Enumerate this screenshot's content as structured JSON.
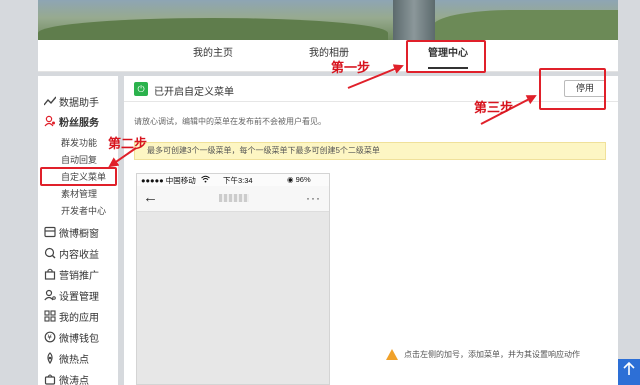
{
  "topnav": {
    "tabs": [
      {
        "label": "我的主页"
      },
      {
        "label": "我的相册"
      },
      {
        "label": "管理中心"
      }
    ]
  },
  "sidebar": {
    "items": [
      {
        "label": "数据助手",
        "icon": "chart-line-icon"
      },
      {
        "label": "粉丝服务",
        "icon": "fans-icon"
      },
      {
        "label": "微博橱窗",
        "icon": "showcase-icon"
      },
      {
        "label": "内容收益",
        "icon": "revenue-icon"
      },
      {
        "label": "营销推广",
        "icon": "marketing-bag-icon"
      },
      {
        "label": "设置管理",
        "icon": "settings-user-icon"
      },
      {
        "label": "我的应用",
        "icon": "apps-grid-icon"
      },
      {
        "label": "微博钱包",
        "icon": "wallet-icon"
      },
      {
        "label": "微热点",
        "icon": "hotspot-icon"
      },
      {
        "label": "微涛点",
        "icon": "bag-icon"
      }
    ],
    "sub_items": [
      {
        "label": "群发功能"
      },
      {
        "label": "自动回复"
      },
      {
        "label": "自定义菜单"
      },
      {
        "label": "素材管理"
      },
      {
        "label": "开发者中心"
      }
    ]
  },
  "main": {
    "title": "已开启自定义菜单",
    "stop_button": "停用",
    "description": "请放心调试，编辑中的菜单在发布前不会被用户看见。",
    "notice": "最多可创建3个一级菜单，每个一级菜单下最多可创建5个二级菜单",
    "tip": "点击左侧的加号，添加菜单，并为其设置响应动作"
  },
  "phone": {
    "carrier": "●●●●● 中国移动",
    "wifi": "WiFi",
    "time": "下午3:34",
    "battery": "◉ 96%",
    "back": "←",
    "more": "···"
  },
  "callouts": {
    "step1": "第一步",
    "step2": "第二步",
    "step3": "第三步"
  },
  "colors": {
    "annotation_red": "#e0202a",
    "power_green": "#2bb24c",
    "notice_yellow": "#fdf6c3",
    "scroll_blue": "#2d6fd6"
  }
}
